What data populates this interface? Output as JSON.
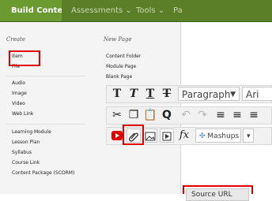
{
  "topnav": {
    "build_content": "Build Content ⌄",
    "assessments": "Assessments ⌄",
    "tools": "Tools ⌄",
    "partial": "Pa"
  },
  "menu": {
    "create_heading": "Create",
    "new_page_heading": "New Page",
    "create_items": [
      "Item",
      "File",
      "Audio",
      "Image",
      "Video",
      "Web Link",
      "Learning Module",
      "Lesson Plan",
      "Syllabus",
      "Course Link",
      "Content Package (SCORM)"
    ],
    "new_page_items": [
      "Content Folder",
      "Module Page",
      "Blank Page"
    ]
  },
  "editor": {
    "row1": {
      "icons": [
        "bold-icon",
        "italic-icon",
        "underline-icon",
        "strikethrough-icon"
      ],
      "paragraph_select": "Paragraph",
      "font_select_partial": "Ari"
    },
    "row2": {
      "icons": [
        "cut-icon",
        "copy-icon",
        "paste-icon",
        "find-icon",
        "undo-icon",
        "redo-icon",
        "align-left-icon",
        "align-center-icon",
        "align-right-icon"
      ]
    },
    "row3": {
      "icons": [
        "youtube-icon",
        "attach-file-icon",
        "insert-image-icon",
        "insert-media-icon",
        "formula-icon"
      ],
      "formula_label": "fx",
      "mashups_label": "Mashups"
    },
    "source_url_label": "Source URL"
  }
}
